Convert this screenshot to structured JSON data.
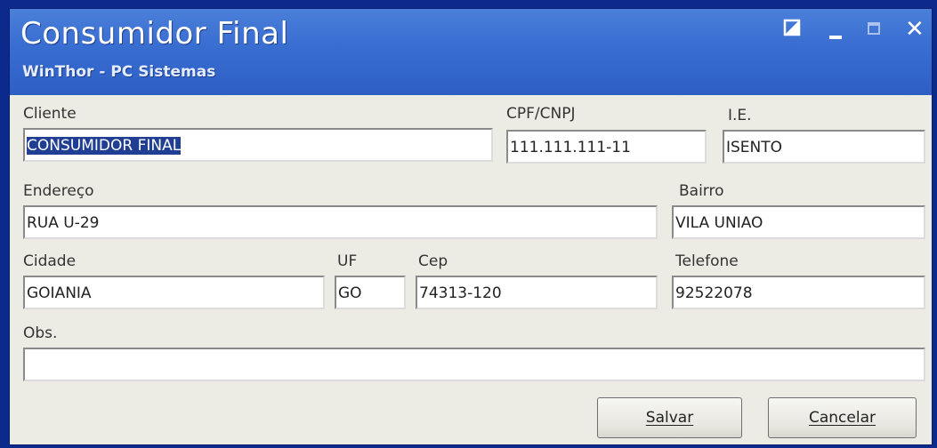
{
  "window": {
    "title": "Consumidor Final",
    "subtitle": "WinThor - PC Sistemas",
    "close_glyph": "✕"
  },
  "form": {
    "cliente": {
      "label": "Cliente",
      "value": "CONSUMIDOR FINAL"
    },
    "cpf_cnpj": {
      "label": "CPF/CNPJ",
      "value": "111.111.111-11"
    },
    "ie": {
      "label": "I.E.",
      "value": "ISENTO"
    },
    "endereco": {
      "label": "Endereço",
      "value": "RUA U-29"
    },
    "bairro": {
      "label": "Bairro",
      "value": "VILA UNIAO"
    },
    "cidade": {
      "label": "Cidade",
      "value": "GOIANIA"
    },
    "uf": {
      "label": "UF",
      "value": "GO"
    },
    "cep": {
      "label": "Cep",
      "value": "74313-120"
    },
    "telefone": {
      "label": "Telefone",
      "value": "92522078"
    },
    "obs": {
      "label": "Obs.",
      "value": ""
    }
  },
  "buttons": {
    "save_label": "Salvar",
    "cancel_label": "Cancelar"
  }
}
